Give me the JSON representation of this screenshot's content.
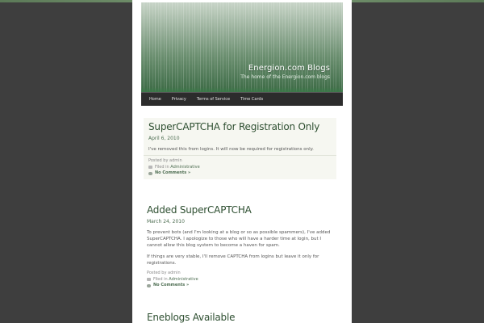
{
  "site": {
    "title": "Energion.com Blogs",
    "tagline": "The home of the Energion.com blogs"
  },
  "nav": {
    "items": [
      {
        "label": "Home"
      },
      {
        "label": "Privacy"
      },
      {
        "label": "Terms of Service"
      },
      {
        "label": "Time Cards"
      }
    ]
  },
  "posts": [
    {
      "title": "SuperCAPTCHA for Registration Only",
      "date": "April 6, 2010",
      "paragraphs": [
        "I've removed this from logins.  It will now be required for registrations only."
      ],
      "posted_by": "Posted by admin",
      "filed_prefix": "Filed in",
      "category": "Administrative",
      "comments": "No Comments »"
    },
    {
      "title": "Added SuperCAPTCHA",
      "date": "March 24, 2010",
      "paragraphs": [
        "To prevent bots (and I'm looking at a blog or so as possible spammers), I've added SuperCAPTCHA.  I apologize to those who will have a harder time at login, but I cannot allow this blog system to become a haven for spam.",
        "If things are very stable, I'll remove CAPTCHA from logins but leave it only for registrations."
      ],
      "posted_by": "Posted by admin",
      "filed_prefix": "Filed in",
      "category": "Administrative",
      "comments": "No Comments »"
    },
    {
      "title": "Eneblogs Available"
    }
  ],
  "colors": {
    "background": "#3e3e3e",
    "nav": "#2c2c2c",
    "accent_green": "#2e4f31"
  }
}
